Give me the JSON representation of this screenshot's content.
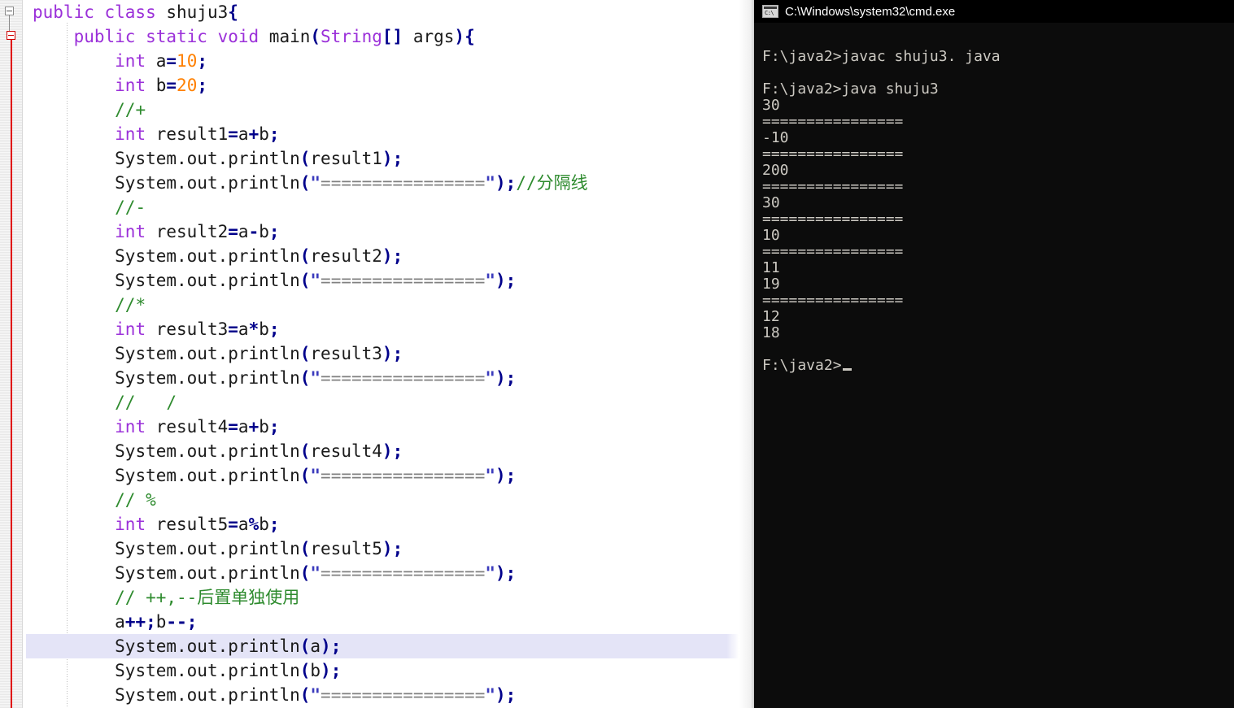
{
  "editor": {
    "name": "java-source-editor",
    "filename": "shuju3.java",
    "font_size_px": 21,
    "colors": {
      "keyword": "#9b30d9",
      "number": "#ff8000",
      "comment": "#2e8b2e",
      "string": "#808080",
      "quote": "#3b3bbd",
      "operator": "#00008b",
      "text": "#1a1a1a",
      "current_line_bg": "#e4e4f7",
      "gutter_fold_red": "#e00000",
      "background": "#ffffff"
    },
    "fold_markers": [
      {
        "level": 1,
        "state": "expanded",
        "color": "#8a8a8a"
      },
      {
        "level": 2,
        "state": "expanded",
        "color": "#d00000"
      }
    ],
    "separator_string": "================",
    "current_line_index": 26,
    "lines": [
      {
        "indent": 0,
        "tokens": [
          {
            "t": "kw",
            "v": "public class "
          },
          {
            "t": "txt",
            "v": "shuju3"
          },
          {
            "t": "pn",
            "v": "{"
          }
        ]
      },
      {
        "indent": 1,
        "tokens": [
          {
            "t": "kw",
            "v": "public static void "
          },
          {
            "t": "txt",
            "v": "main"
          },
          {
            "t": "pn",
            "v": "("
          },
          {
            "t": "kw",
            "v": "String"
          },
          {
            "t": "pn",
            "v": "[]"
          },
          {
            "t": "txt",
            "v": " args"
          },
          {
            "t": "pn",
            "v": ")"
          },
          {
            "t": "pn",
            "v": "{"
          }
        ]
      },
      {
        "indent": 2,
        "tokens": [
          {
            "t": "kw",
            "v": "int"
          },
          {
            "t": "txt",
            "v": " a"
          },
          {
            "t": "op",
            "v": "="
          },
          {
            "t": "num",
            "v": "10"
          },
          {
            "t": "pn",
            "v": ";"
          }
        ]
      },
      {
        "indent": 2,
        "tokens": [
          {
            "t": "kw",
            "v": "int"
          },
          {
            "t": "txt",
            "v": " b"
          },
          {
            "t": "op",
            "v": "="
          },
          {
            "t": "num",
            "v": "20"
          },
          {
            "t": "pn",
            "v": ";"
          }
        ]
      },
      {
        "indent": 2,
        "tokens": [
          {
            "t": "cmt",
            "v": "//+"
          }
        ]
      },
      {
        "indent": 2,
        "tokens": [
          {
            "t": "kw",
            "v": "int"
          },
          {
            "t": "txt",
            "v": " result1"
          },
          {
            "t": "op",
            "v": "="
          },
          {
            "t": "txt",
            "v": "a"
          },
          {
            "t": "op",
            "v": "+"
          },
          {
            "t": "txt",
            "v": "b"
          },
          {
            "t": "pn",
            "v": ";"
          }
        ]
      },
      {
        "indent": 2,
        "tokens": [
          {
            "t": "txt",
            "v": "System.out.println"
          },
          {
            "t": "pn",
            "v": "("
          },
          {
            "t": "txt",
            "v": "result1"
          },
          {
            "t": "pn",
            "v": ")"
          },
          {
            "t": "pn",
            "v": ";"
          }
        ]
      },
      {
        "indent": 2,
        "tokens": [
          {
            "t": "txt",
            "v": "System.out.println"
          },
          {
            "t": "pn",
            "v": "("
          },
          {
            "t": "quo",
            "v": "\""
          },
          {
            "t": "str",
            "v": "================"
          },
          {
            "t": "quo",
            "v": "\""
          },
          {
            "t": "pn",
            "v": ")"
          },
          {
            "t": "pn",
            "v": ";"
          },
          {
            "t": "cmt",
            "v": "//分隔线"
          }
        ]
      },
      {
        "indent": 2,
        "tokens": [
          {
            "t": "cmt",
            "v": "//-"
          }
        ]
      },
      {
        "indent": 2,
        "tokens": [
          {
            "t": "kw",
            "v": "int"
          },
          {
            "t": "txt",
            "v": " result2"
          },
          {
            "t": "op",
            "v": "="
          },
          {
            "t": "txt",
            "v": "a"
          },
          {
            "t": "op",
            "v": "-"
          },
          {
            "t": "txt",
            "v": "b"
          },
          {
            "t": "pn",
            "v": ";"
          }
        ]
      },
      {
        "indent": 2,
        "tokens": [
          {
            "t": "txt",
            "v": "System.out.println"
          },
          {
            "t": "pn",
            "v": "("
          },
          {
            "t": "txt",
            "v": "result2"
          },
          {
            "t": "pn",
            "v": ")"
          },
          {
            "t": "pn",
            "v": ";"
          }
        ]
      },
      {
        "indent": 2,
        "tokens": [
          {
            "t": "txt",
            "v": "System.out.println"
          },
          {
            "t": "pn",
            "v": "("
          },
          {
            "t": "quo",
            "v": "\""
          },
          {
            "t": "str",
            "v": "================"
          },
          {
            "t": "quo",
            "v": "\""
          },
          {
            "t": "pn",
            "v": ")"
          },
          {
            "t": "pn",
            "v": ";"
          }
        ]
      },
      {
        "indent": 2,
        "tokens": [
          {
            "t": "cmt",
            "v": "//*"
          }
        ]
      },
      {
        "indent": 2,
        "tokens": [
          {
            "t": "kw",
            "v": "int"
          },
          {
            "t": "txt",
            "v": " result3"
          },
          {
            "t": "op",
            "v": "="
          },
          {
            "t": "txt",
            "v": "a"
          },
          {
            "t": "op",
            "v": "*"
          },
          {
            "t": "txt",
            "v": "b"
          },
          {
            "t": "pn",
            "v": ";"
          }
        ]
      },
      {
        "indent": 2,
        "tokens": [
          {
            "t": "txt",
            "v": "System.out.println"
          },
          {
            "t": "pn",
            "v": "("
          },
          {
            "t": "txt",
            "v": "result3"
          },
          {
            "t": "pn",
            "v": ")"
          },
          {
            "t": "pn",
            "v": ";"
          }
        ]
      },
      {
        "indent": 2,
        "tokens": [
          {
            "t": "txt",
            "v": "System.out.println"
          },
          {
            "t": "pn",
            "v": "("
          },
          {
            "t": "quo",
            "v": "\""
          },
          {
            "t": "str",
            "v": "================"
          },
          {
            "t": "quo",
            "v": "\""
          },
          {
            "t": "pn",
            "v": ")"
          },
          {
            "t": "pn",
            "v": ";"
          }
        ]
      },
      {
        "indent": 2,
        "tokens": [
          {
            "t": "cmt",
            "v": "//   /"
          }
        ]
      },
      {
        "indent": 2,
        "tokens": [
          {
            "t": "kw",
            "v": "int"
          },
          {
            "t": "txt",
            "v": " result4"
          },
          {
            "t": "op",
            "v": "="
          },
          {
            "t": "txt",
            "v": "a"
          },
          {
            "t": "op",
            "v": "+"
          },
          {
            "t": "txt",
            "v": "b"
          },
          {
            "t": "pn",
            "v": ";"
          }
        ]
      },
      {
        "indent": 2,
        "tokens": [
          {
            "t": "txt",
            "v": "System.out.println"
          },
          {
            "t": "pn",
            "v": "("
          },
          {
            "t": "txt",
            "v": "result4"
          },
          {
            "t": "pn",
            "v": ")"
          },
          {
            "t": "pn",
            "v": ";"
          }
        ]
      },
      {
        "indent": 2,
        "tokens": [
          {
            "t": "txt",
            "v": "System.out.println"
          },
          {
            "t": "pn",
            "v": "("
          },
          {
            "t": "quo",
            "v": "\""
          },
          {
            "t": "str",
            "v": "================"
          },
          {
            "t": "quo",
            "v": "\""
          },
          {
            "t": "pn",
            "v": ")"
          },
          {
            "t": "pn",
            "v": ";"
          }
        ]
      },
      {
        "indent": 2,
        "tokens": [
          {
            "t": "cmt",
            "v": "// %"
          }
        ]
      },
      {
        "indent": 2,
        "tokens": [
          {
            "t": "kw",
            "v": "int"
          },
          {
            "t": "txt",
            "v": " result5"
          },
          {
            "t": "op",
            "v": "="
          },
          {
            "t": "txt",
            "v": "a"
          },
          {
            "t": "op",
            "v": "%"
          },
          {
            "t": "txt",
            "v": "b"
          },
          {
            "t": "pn",
            "v": ";"
          }
        ]
      },
      {
        "indent": 2,
        "tokens": [
          {
            "t": "txt",
            "v": "System.out.println"
          },
          {
            "t": "pn",
            "v": "("
          },
          {
            "t": "txt",
            "v": "result5"
          },
          {
            "t": "pn",
            "v": ")"
          },
          {
            "t": "pn",
            "v": ";"
          }
        ]
      },
      {
        "indent": 2,
        "tokens": [
          {
            "t": "txt",
            "v": "System.out.println"
          },
          {
            "t": "pn",
            "v": "("
          },
          {
            "t": "quo",
            "v": "\""
          },
          {
            "t": "str",
            "v": "================"
          },
          {
            "t": "quo",
            "v": "\""
          },
          {
            "t": "pn",
            "v": ")"
          },
          {
            "t": "pn",
            "v": ";"
          }
        ]
      },
      {
        "indent": 2,
        "tokens": [
          {
            "t": "cmt",
            "v": "// ++,--后置单独使用"
          }
        ]
      },
      {
        "indent": 2,
        "tokens": [
          {
            "t": "txt",
            "v": "a"
          },
          {
            "t": "op",
            "v": "++"
          },
          {
            "t": "pn",
            "v": ";"
          },
          {
            "t": "txt",
            "v": "b"
          },
          {
            "t": "op",
            "v": "--"
          },
          {
            "t": "pn",
            "v": ";"
          }
        ]
      },
      {
        "indent": 2,
        "tokens": [
          {
            "t": "txt",
            "v": "System.out.println"
          },
          {
            "t": "pn",
            "v": "("
          },
          {
            "t": "txt",
            "v": "a"
          },
          {
            "t": "pn",
            "v": ")"
          },
          {
            "t": "pn",
            "v": ";"
          }
        ]
      },
      {
        "indent": 2,
        "tokens": [
          {
            "t": "txt",
            "v": "System.out.println"
          },
          {
            "t": "pn",
            "v": "("
          },
          {
            "t": "txt",
            "v": "b"
          },
          {
            "t": "pn",
            "v": ")"
          },
          {
            "t": "pn",
            "v": ";"
          }
        ]
      },
      {
        "indent": 2,
        "tokens": [
          {
            "t": "txt",
            "v": "System.out.println"
          },
          {
            "t": "pn",
            "v": "("
          },
          {
            "t": "quo",
            "v": "\""
          },
          {
            "t": "str",
            "v": "================"
          },
          {
            "t": "quo",
            "v": "\""
          },
          {
            "t": "pn",
            "v": ")"
          },
          {
            "t": "pn",
            "v": ";"
          }
        ]
      }
    ]
  },
  "console": {
    "name": "cmd-window",
    "title": "C:\\Windows\\system32\\cmd.exe",
    "icon": "cmd-icon",
    "icon_glyph": "C:\\",
    "background": "#0c0c0c",
    "foreground": "#ccc9c2",
    "prompt": "F:\\java2>",
    "lines": [
      "",
      "F:\\java2>javac shuju3. java",
      "",
      "F:\\java2>java shuju3",
      "30",
      "================",
      "-10",
      "================",
      "200",
      "================",
      "30",
      "================",
      "10",
      "================",
      "11",
      "19",
      "================",
      "12",
      "18",
      "",
      "F:\\java2>"
    ],
    "caret_line_index": 20,
    "commands": [
      "javac shuju3. java",
      "java shuju3"
    ],
    "program_output": [
      "30",
      "================",
      "-10",
      "================",
      "200",
      "================",
      "30",
      "================",
      "10",
      "================",
      "11",
      "19",
      "================",
      "12",
      "18"
    ]
  }
}
